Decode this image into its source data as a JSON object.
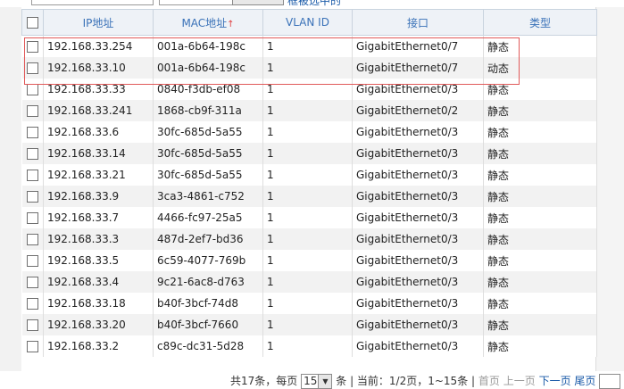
{
  "top": {
    "link_text": "框被选中的"
  },
  "table": {
    "headers": {
      "ip": "IP地址",
      "mac": "MAC地址",
      "sort_arrow": "↑",
      "vlan": "VLAN ID",
      "iface": "接口",
      "type": "类型"
    },
    "rows": [
      {
        "ip": "192.168.33.254",
        "mac": "001a-6b64-198c",
        "vlan": "1",
        "iface": "GigabitEthernet0/7",
        "type": "静态"
      },
      {
        "ip": "192.168.33.10",
        "mac": "001a-6b64-198c",
        "vlan": "1",
        "iface": "GigabitEthernet0/7",
        "type": "动态"
      },
      {
        "ip": "192.168.33.33",
        "mac": "0840-f3db-ef08",
        "vlan": "1",
        "iface": "GigabitEthernet0/3",
        "type": "静态"
      },
      {
        "ip": "192.168.33.241",
        "mac": "1868-cb9f-311a",
        "vlan": "1",
        "iface": "GigabitEthernet0/2",
        "type": "静态"
      },
      {
        "ip": "192.168.33.6",
        "mac": "30fc-685d-5a55",
        "vlan": "1",
        "iface": "GigabitEthernet0/3",
        "type": "静态"
      },
      {
        "ip": "192.168.33.14",
        "mac": "30fc-685d-5a55",
        "vlan": "1",
        "iface": "GigabitEthernet0/3",
        "type": "静态"
      },
      {
        "ip": "192.168.33.21",
        "mac": "30fc-685d-5a55",
        "vlan": "1",
        "iface": "GigabitEthernet0/3",
        "type": "静态"
      },
      {
        "ip": "192.168.33.9",
        "mac": "3ca3-4861-c752",
        "vlan": "1",
        "iface": "GigabitEthernet0/3",
        "type": "静态"
      },
      {
        "ip": "192.168.33.7",
        "mac": "4466-fc97-25a5",
        "vlan": "1",
        "iface": "GigabitEthernet0/3",
        "type": "静态"
      },
      {
        "ip": "192.168.33.3",
        "mac": "487d-2ef7-bd36",
        "vlan": "1",
        "iface": "GigabitEthernet0/3",
        "type": "静态"
      },
      {
        "ip": "192.168.33.5",
        "mac": "6c59-4077-769b",
        "vlan": "1",
        "iface": "GigabitEthernet0/3",
        "type": "静态"
      },
      {
        "ip": "192.168.33.4",
        "mac": "9c21-6ac8-d763",
        "vlan": "1",
        "iface": "GigabitEthernet0/3",
        "type": "静态"
      },
      {
        "ip": "192.168.33.18",
        "mac": "b40f-3bcf-74d8",
        "vlan": "1",
        "iface": "GigabitEthernet0/3",
        "type": "静态"
      },
      {
        "ip": "192.168.33.20",
        "mac": "b40f-3bcf-7660",
        "vlan": "1",
        "iface": "GigabitEthernet0/3",
        "type": "静态"
      },
      {
        "ip": "192.168.33.2",
        "mac": "c89c-dc31-5d28",
        "vlan": "1",
        "iface": "GigabitEthernet0/3",
        "type": "静态"
      }
    ]
  },
  "footer": {
    "total": "共17条，每页",
    "page_size": "15",
    "after_size": "条",
    "current": "| 当前：1/2页，1~15条 |",
    "first": "首页",
    "prev": "上一页",
    "next": "下一页",
    "last": "尾页"
  },
  "colors": {
    "header_text": "#3a72b8",
    "highlight_border": "#e15a5a",
    "link": "#1a5aa8"
  }
}
